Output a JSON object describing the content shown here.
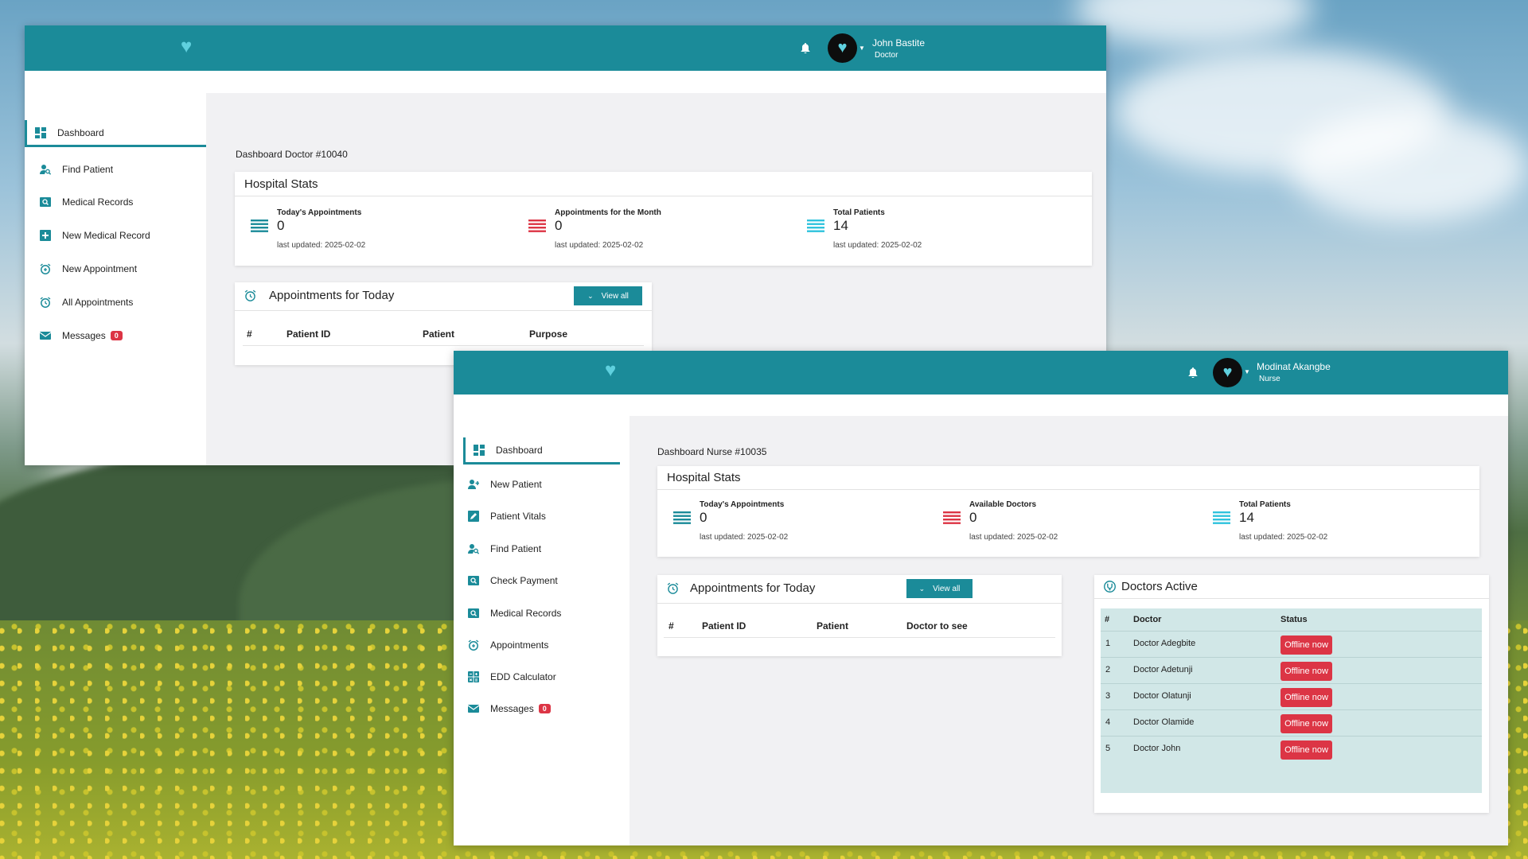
{
  "doctor_window": {
    "user": {
      "name": "John Bastite",
      "role": "Doctor"
    },
    "sidebar": [
      {
        "label": "Dashboard",
        "icon": "dashboard-icon",
        "active": true
      },
      {
        "label": "Find Patient",
        "icon": "find-patient-icon"
      },
      {
        "label": "Medical Records",
        "icon": "medical-records-icon"
      },
      {
        "label": "New Medical Record",
        "icon": "plus-square-icon"
      },
      {
        "label": "New Appointment",
        "icon": "alarm-plus-icon"
      },
      {
        "label": "All Appointments",
        "icon": "alarm-icon"
      },
      {
        "label": "Messages",
        "icon": "mail-icon",
        "badge": "0"
      }
    ],
    "dashboard_title": "Dashboard Doctor #10040",
    "stats_title": "Hospital Stats",
    "stats": [
      {
        "label": "Today's Appointments",
        "value": "0",
        "updated": "last updated: 2025-02-02",
        "color": "#1b8b99"
      },
      {
        "label": "Appointments for the Month",
        "value": "0",
        "updated": "last updated: 2025-02-02",
        "color": "#dc3545"
      },
      {
        "label": "Total Patients",
        "value": "14",
        "updated": "last updated: 2025-02-02",
        "color": "#2fc3dd"
      }
    ],
    "appointments_title": "Appointments for Today",
    "view_all": "View all",
    "columns": [
      "#",
      "Patient ID",
      "Patient",
      "Purpose"
    ]
  },
  "nurse_window": {
    "user": {
      "name": "Modinat Akangbe",
      "role": "Nurse"
    },
    "sidebar": [
      {
        "label": "Dashboard",
        "icon": "dashboard-icon",
        "active": true
      },
      {
        "label": "New Patient",
        "icon": "user-plus-icon"
      },
      {
        "label": "Patient Vitals",
        "icon": "edit-icon"
      },
      {
        "label": "Find Patient",
        "icon": "find-patient-icon"
      },
      {
        "label": "Check Payment",
        "icon": "payment-icon"
      },
      {
        "label": "Medical Records",
        "icon": "medical-records-icon"
      },
      {
        "label": "Appointments",
        "icon": "alarm-plus-icon"
      },
      {
        "label": "EDD Calculator",
        "icon": "calculator-icon"
      },
      {
        "label": "Messages",
        "icon": "mail-icon",
        "badge": "0"
      }
    ],
    "dashboard_title": "Dashboard Nurse #10035",
    "stats_title": "Hospital Stats",
    "stats": [
      {
        "label": "Today's Appointments",
        "value": "0",
        "updated": "last updated: 2025-02-02",
        "color": "#1b8b99"
      },
      {
        "label": "Available Doctors",
        "value": "0",
        "updated": "last updated: 2025-02-02",
        "color": "#dc3545"
      },
      {
        "label": "Total Patients",
        "value": "14",
        "updated": "last updated: 2025-02-02",
        "color": "#2fc3dd"
      }
    ],
    "appointments_title": "Appointments for Today",
    "view_all": "View all",
    "columns": [
      "#",
      "Patient ID",
      "Patient",
      "Doctor to see"
    ],
    "doctors_title": "Doctors Active",
    "doctor_columns": [
      "#",
      "Doctor",
      "Status"
    ],
    "doctors": [
      {
        "n": "1",
        "name": "Doctor Adegbite",
        "status": "Offline now"
      },
      {
        "n": "2",
        "name": "Doctor Adetunji",
        "status": "Offline now"
      },
      {
        "n": "3",
        "name": "Doctor Olatunji",
        "status": "Offline now"
      },
      {
        "n": "4",
        "name": "Doctor Olamide",
        "status": "Offline now"
      },
      {
        "n": "5",
        "name": "Doctor John",
        "status": "Offline now"
      }
    ]
  },
  "colors": {
    "primary": "#1b8b99",
    "danger": "#dc3545",
    "accent": "#2fc3dd",
    "table_bg": "#d1e7e7"
  }
}
